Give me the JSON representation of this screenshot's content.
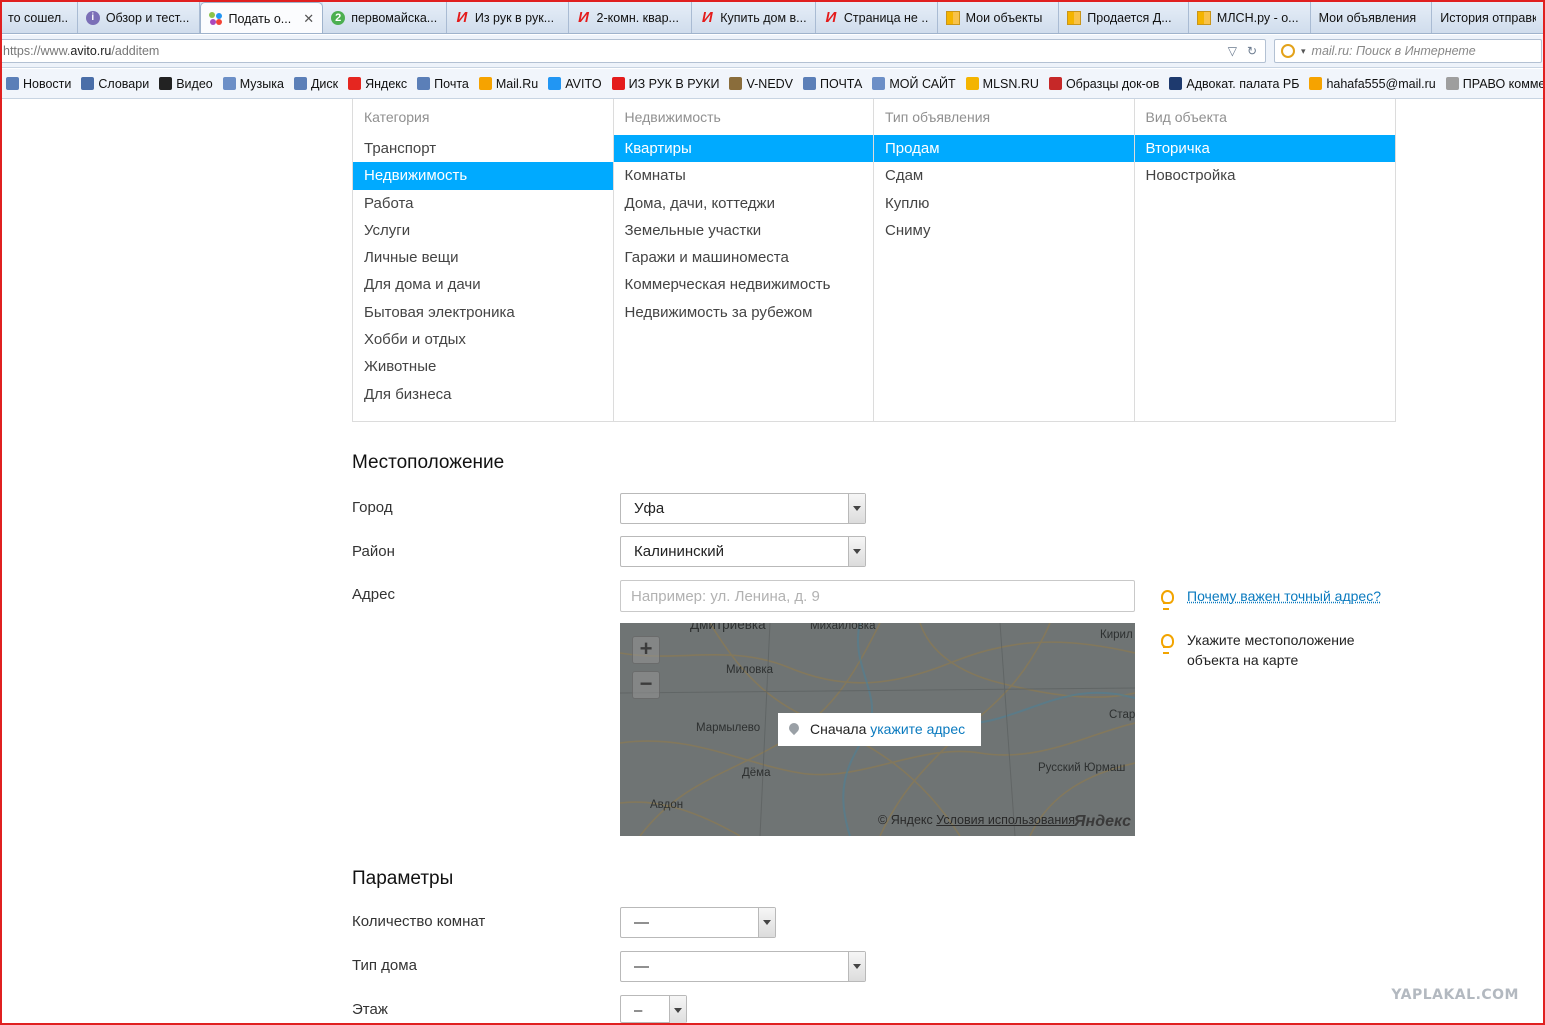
{
  "browser": {
    "tabs": [
      {
        "label": "то сошел...",
        "icon": "none"
      },
      {
        "label": "Обзор и тест...",
        "icon": "info-icon"
      },
      {
        "label": "Подать о...",
        "icon": "avito-icon",
        "active": true
      },
      {
        "label": "первомайска...",
        "icon": "two-gis-icon"
      },
      {
        "label": "Из рук в рук...",
        "icon": "irr-icon"
      },
      {
        "label": "2-комн. квар...",
        "icon": "irr-icon"
      },
      {
        "label": "Купить дом в...",
        "icon": "irr-icon"
      },
      {
        "label": "Страница не ...",
        "icon": "irr-icon"
      },
      {
        "label": "Мои объекты",
        "icon": "mlsn-icon"
      },
      {
        "label": "Продается Д...",
        "icon": "mlsn-icon"
      },
      {
        "label": "МЛСН.ру - о...",
        "icon": "mlsn-icon"
      },
      {
        "label": "Мои объявления",
        "icon": "none"
      },
      {
        "label": "История отправк...",
        "icon": "none"
      }
    ],
    "tab_close": "✕",
    "url_prefix": "https://www.",
    "url_domain": "avito.ru",
    "url_path": "/additem",
    "search_placeholder": "mail.ru: Поиск в Интернете",
    "bookmarks": [
      {
        "label": "Новости",
        "color": "#5b7fb8"
      },
      {
        "label": "Словари",
        "color": "#4a6ea8"
      },
      {
        "label": "Видео",
        "color": "#222222"
      },
      {
        "label": "Музыка",
        "color": "#6c8fc7"
      },
      {
        "label": "Диск",
        "color": "#5b7fb8"
      },
      {
        "label": "Яндекс",
        "color": "#e52620"
      },
      {
        "label": "Почта",
        "color": "#5b7fb8"
      },
      {
        "label": "Mail.Ru",
        "color": "#f6a300"
      },
      {
        "label": "AVITO",
        "color": "#2196f3"
      },
      {
        "label": "ИЗ РУК В РУКИ",
        "color": "#e41b1b"
      },
      {
        "label": "V-NEDV",
        "color": "#8a6d3b"
      },
      {
        "label": "ПОЧТА",
        "color": "#5b7fb8"
      },
      {
        "label": "МОЙ САЙТ",
        "color": "#6c8fc7"
      },
      {
        "label": "MLSN.RU",
        "color": "#f4b400"
      },
      {
        "label": "Образцы док-ов",
        "color": "#c62828"
      },
      {
        "label": "Адвокат. палата РБ",
        "color": "#1e3a6e"
      },
      {
        "label": "hahafa555@mail.ru",
        "color": "#f6a300"
      },
      {
        "label": "ПРАВО комменты",
        "color": "#9e9e9e"
      }
    ]
  },
  "category": {
    "columns": [
      {
        "header": "Категория",
        "items": [
          "Транспорт",
          "Недвижимость",
          "Работа",
          "Услуги",
          "Личные вещи",
          "Для дома и дачи",
          "Бытовая электроника",
          "Хобби и отдых",
          "Животные",
          "Для бизнеса"
        ],
        "selected": 1
      },
      {
        "header": "Недвижимость",
        "items": [
          "Квартиры",
          "Комнаты",
          "Дома, дачи, коттеджи",
          "Земельные участки",
          "Гаражи и машиноместа",
          "Коммерческая недвижимость",
          "Недвижимость за рубежом"
        ],
        "selected": 0
      },
      {
        "header": "Тип объявления",
        "items": [
          "Продам",
          "Сдам",
          "Куплю",
          "Сниму"
        ],
        "selected": 0
      },
      {
        "header": "Вид объекта",
        "items": [
          "Вторичка",
          "Новостройка"
        ],
        "selected": 0
      }
    ],
    "accent_color": "#00aaff"
  },
  "location": {
    "title": "Местоположение",
    "city_label": "Город",
    "city_value": "Уфа",
    "district_label": "Район",
    "district_value": "Калининский",
    "address_label": "Адрес",
    "address_placeholder": "Например: ул. Ленина, д. 9",
    "address_value": "",
    "hint_address_link": "Почему важен точный адрес?",
    "hint_map_text": "Укажите местоположение объекта на карте",
    "map": {
      "zoom_in": "+",
      "zoom_out": "−",
      "popup_prefix": "Сначала",
      "popup_link": "укажите адрес",
      "copyright": "© Яндекс",
      "terms_link": "Условия использования",
      "logo": "Яндекс",
      "towns": [
        "Дмитриевка",
        "Михайловка",
        "Кирил",
        "Миловка",
        "Мармылево",
        "Дёма",
        "Авдон",
        "Русский Юрмаш",
        "Стар"
      ]
    }
  },
  "params": {
    "title": "Параметры",
    "rooms_label": "Количество комнат",
    "rooms_value": "—",
    "house_type_label": "Тип дома",
    "house_type_value": "—",
    "floor_label": "Этаж",
    "floor_value": "–"
  },
  "watermark": "YAPLAKAL.COM"
}
